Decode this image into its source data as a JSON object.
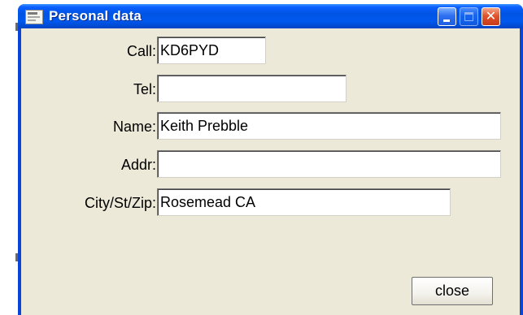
{
  "window": {
    "title": "Personal data",
    "title_bar_color": "#0054e3",
    "client_background": "#ece9d8",
    "close_glyph": "✕"
  },
  "form": {
    "fields": [
      {
        "label": "Call:",
        "value": "KD6PYD"
      },
      {
        "label": "Tel:",
        "value": ""
      },
      {
        "label": "Name:",
        "value": "Keith Prebble"
      },
      {
        "label": "Addr:",
        "value": ""
      },
      {
        "label": "City/St/Zip:",
        "value": "Rosemead CA"
      }
    ]
  },
  "buttons": {
    "close_label": "close"
  },
  "icons": {
    "app": "window-app-icon",
    "minimize": "minimize-icon",
    "maximize": "maximize-icon",
    "close": "close-icon"
  }
}
